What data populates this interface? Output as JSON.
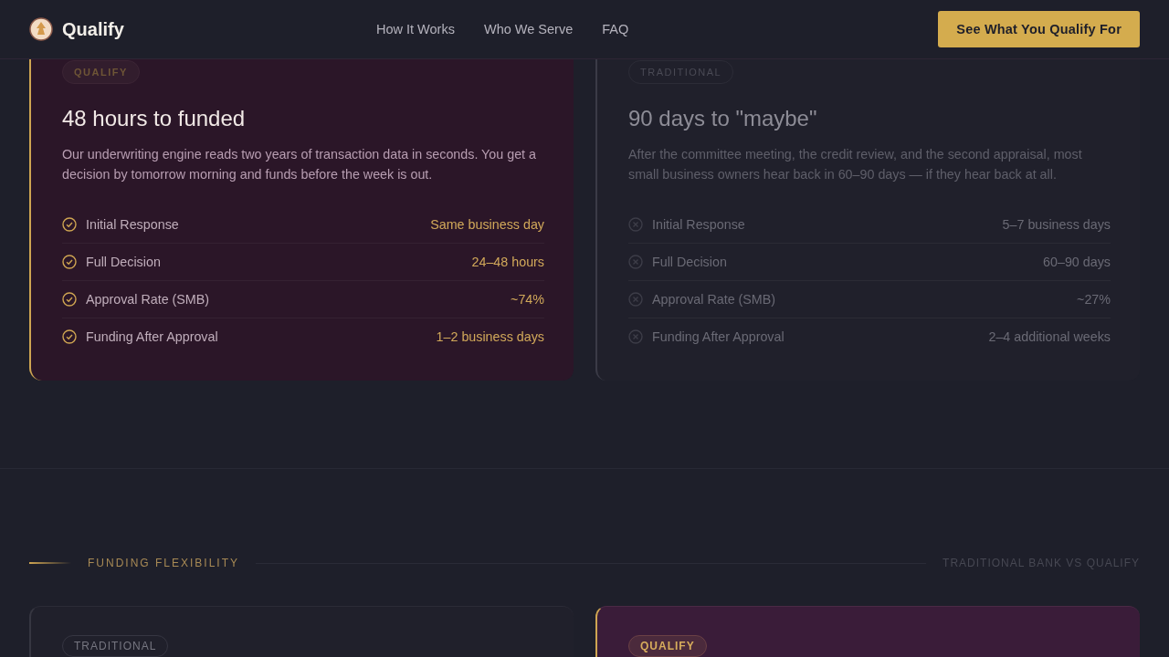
{
  "header": {
    "brand": "Qualify",
    "nav": [
      "How It Works",
      "Who We Serve",
      "FAQ"
    ],
    "cta": "See What You Qualify For"
  },
  "comparison_cards": [
    {
      "kind": "qualify",
      "badge": "QUALIFY",
      "title": "48 hours to funded",
      "description": "Our underwriting engine reads two years of transaction data in seconds. You get a decision by tomorrow morning and funds before the week is out.",
      "rows": [
        {
          "label": "Initial Response",
          "value": "Same business day"
        },
        {
          "label": "Full Decision",
          "value": "24–48 hours"
        },
        {
          "label": "Approval Rate (SMB)",
          "value": "~74%"
        },
        {
          "label": "Funding After Approval",
          "value": "1–2 business days"
        }
      ]
    },
    {
      "kind": "traditional",
      "badge": "TRADITIONAL",
      "title": "90 days to \"maybe\"",
      "description": "After the committee meeting, the credit review, and the second appraisal, most small business owners hear back in 60–90 days — if they hear back at all.",
      "rows": [
        {
          "label": "Initial Response",
          "value": "5–7 business days"
        },
        {
          "label": "Full Decision",
          "value": "60–90 days"
        },
        {
          "label": "Approval Rate (SMB)",
          "value": "~27%"
        },
        {
          "label": "Funding After Approval",
          "value": "2–4 additional weeks"
        }
      ]
    }
  ],
  "section": {
    "eyebrow": "FUNDING FLEXIBILITY",
    "aside": "TRADITIONAL BANK VS QUALIFY"
  },
  "flex_cards": [
    {
      "kind": "traditional",
      "badge": "TRADITIONAL"
    },
    {
      "kind": "qualify",
      "badge": "QUALIFY"
    }
  ]
}
